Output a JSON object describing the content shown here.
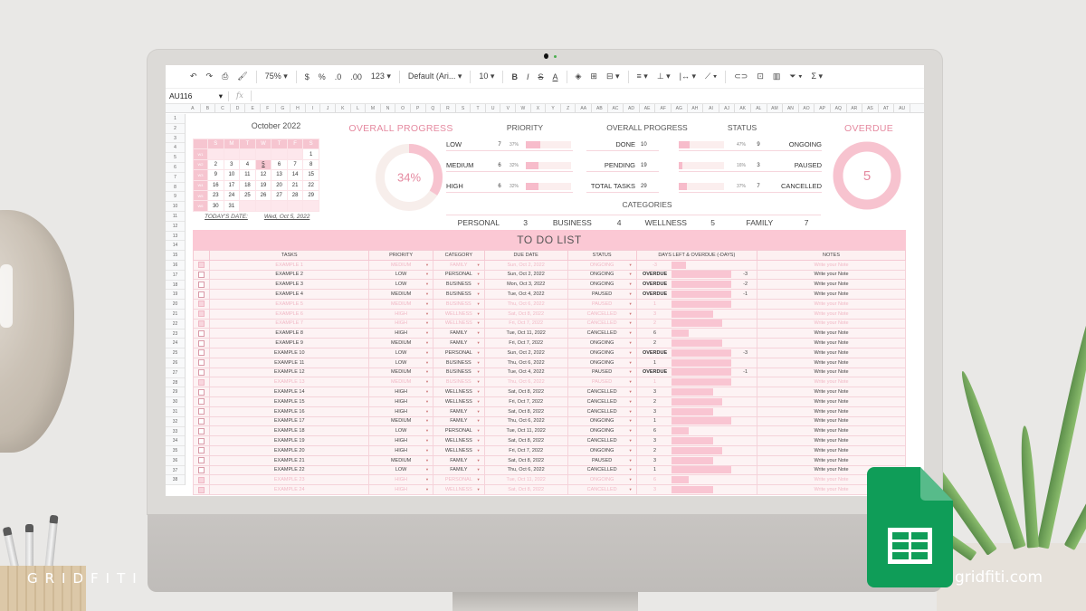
{
  "branding": {
    "watermark_left": "GRIDFITI",
    "watermark_right": "gridfiti.com",
    "app_icon": "google-sheets-icon"
  },
  "toolbar": {
    "items": [
      {
        "name": "undo-icon",
        "glyph": "↶"
      },
      {
        "name": "redo-icon",
        "glyph": "↷"
      },
      {
        "name": "print-icon",
        "glyph": "⎙"
      },
      {
        "name": "paint-format-icon",
        "glyph": "🖌"
      },
      {
        "name": "zoom-select",
        "label": "75%  ▾"
      },
      {
        "name": "currency-button",
        "label": "$"
      },
      {
        "name": "percent-button",
        "label": "%"
      },
      {
        "name": "decrease-decimal-button",
        "label": ".0"
      },
      {
        "name": "increase-decimal-button",
        "label": ".00"
      },
      {
        "name": "more-formats-button",
        "label": "123 ▾"
      },
      {
        "name": "font-select",
        "label": "Default (Ari...  ▾"
      },
      {
        "name": "font-size-select",
        "label": "10      ▾"
      },
      {
        "name": "bold-button",
        "label": "B"
      },
      {
        "name": "italic-button",
        "label": "I"
      },
      {
        "name": "strikethrough-button",
        "label": "S"
      },
      {
        "name": "text-color-button",
        "label": "A"
      },
      {
        "name": "fill-color-icon",
        "glyph": "◈"
      },
      {
        "name": "borders-icon",
        "glyph": "⊞"
      },
      {
        "name": "merge-cells-icon",
        "glyph": "⊟ ▾"
      },
      {
        "name": "align-icon",
        "glyph": "≡ ▾"
      },
      {
        "name": "valign-icon",
        "glyph": "⊥ ▾"
      },
      {
        "name": "wrap-icon",
        "glyph": "|↔ ▾"
      },
      {
        "name": "rotate-icon",
        "glyph": "⟋ ▾"
      },
      {
        "name": "link-icon",
        "glyph": "⊂⊃"
      },
      {
        "name": "comment-icon",
        "glyph": "⊡"
      },
      {
        "name": "chart-icon",
        "glyph": "▥"
      },
      {
        "name": "filter-icon",
        "glyph": "⏷ ▾"
      },
      {
        "name": "functions-icon",
        "glyph": "Σ ▾"
      }
    ]
  },
  "formula_bar": {
    "cell_ref": "AU116",
    "fx": "fx",
    "value": ""
  },
  "columns": [
    "A",
    "B",
    "C",
    "D",
    "E",
    "F",
    "G",
    "H",
    "I",
    "J",
    "K",
    "L",
    "M",
    "N",
    "O",
    "P",
    "Q",
    "R",
    "S",
    "T",
    "U",
    "V",
    "W",
    "X",
    "Y",
    "Z",
    "AA",
    "AB",
    "AC",
    "AD",
    "AE",
    "AF",
    "AG",
    "AH",
    "AI",
    "AJ",
    "AK",
    "AL",
    "AM",
    "AN",
    "AO",
    "AP",
    "AQ",
    "AR",
    "AS",
    "AT",
    "AU"
  ],
  "rows": [
    "1",
    "2",
    "3",
    "4",
    "5",
    "6",
    "7",
    "8",
    "9",
    "10",
    "11",
    "12",
    "13",
    "14",
    "15",
    "16",
    "17",
    "18",
    "19",
    "20",
    "21",
    "22",
    "23",
    "24",
    "25",
    "26",
    "27",
    "28",
    "29",
    "30",
    "31",
    "32",
    "33",
    "34",
    "35",
    "36",
    "37",
    "38"
  ],
  "calendar": {
    "title": "October 2022",
    "weekdays": [
      "S",
      "M",
      "T",
      "W",
      "T",
      "F",
      "S"
    ],
    "weeks": [
      {
        "wk": "W1",
        "days": [
          "",
          "",
          "",
          "",
          "",
          "",
          "1"
        ]
      },
      {
        "wk": "W2",
        "days": [
          "2",
          "3",
          "4",
          "5",
          "6",
          "7",
          "8"
        ]
      },
      {
        "wk": "W3",
        "days": [
          "9",
          "10",
          "11",
          "12",
          "13",
          "14",
          "15"
        ]
      },
      {
        "wk": "W4",
        "days": [
          "16",
          "17",
          "18",
          "19",
          "20",
          "21",
          "22"
        ]
      },
      {
        "wk": "W5",
        "days": [
          "23",
          "24",
          "25",
          "26",
          "27",
          "28",
          "29"
        ]
      },
      {
        "wk": "W6",
        "days": [
          "30",
          "31",
          "",
          "",
          "",
          "",
          ""
        ]
      }
    ],
    "today_label": "TODAY'S DATE:",
    "today_value": "Wed, Oct 5, 2022",
    "today_day": "5"
  },
  "overall_progress": {
    "title": "OVERALL PROGRESS",
    "percent_label": "34%",
    "fraction": 0.34
  },
  "priority": {
    "title": "PRIORITY",
    "rows": [
      {
        "label": "LOW",
        "count": "7",
        "pct": "37%",
        "fraction": 0.37
      },
      {
        "label": "MEDIUM",
        "count": "6",
        "pct": "32%",
        "fraction": 0.32
      },
      {
        "label": "HIGH",
        "count": "6",
        "pct": "32%",
        "fraction": 0.32
      }
    ]
  },
  "overall_counts": {
    "title": "OVERALL PROGRESS",
    "rows": [
      {
        "label": "DONE",
        "value": "10"
      },
      {
        "label": "PENDING",
        "value": "19"
      },
      {
        "label": "TOTAL TASKS",
        "value": "29"
      }
    ]
  },
  "status": {
    "title": "STATUS",
    "rows": [
      {
        "label": "ONGOING",
        "count": "9",
        "pct": "47%",
        "fraction": 0.47
      },
      {
        "label": "PAUSED",
        "count": "3",
        "pct": "16%",
        "fraction": 0.16
      },
      {
        "label": "CANCELLED",
        "count": "7",
        "pct": "37%",
        "fraction": 0.37
      }
    ]
  },
  "overdue": {
    "title": "OVERDUE",
    "value": "5"
  },
  "categories": {
    "title": "CATEGORIES",
    "items": [
      {
        "label": "PERSONAL",
        "value": "3"
      },
      {
        "label": "BUSINESS",
        "value": "4"
      },
      {
        "label": "WELLNESS",
        "value": "5"
      },
      {
        "label": "FAMILY",
        "value": "7"
      }
    ]
  },
  "todo": {
    "title": "TO DO LIST",
    "headers": [
      "",
      "TASKS",
      "PRIORITY",
      "CATEGORY",
      "DUE DATE",
      "STATUS",
      "DAYS LEFT & OVERDUE (-DAYS)",
      "NOTES"
    ],
    "rows": [
      {
        "done": true,
        "task": "EXAMPLE 1",
        "priority": "MEDIUM",
        "category": "FAMILY",
        "due": "Sun, Oct 2, 2022",
        "status": "ONGOING",
        "days": "-3",
        "overdue": "",
        "bar": 0.25,
        "note": "Write your Note"
      },
      {
        "done": false,
        "task": "EXAMPLE 2",
        "priority": "LOW",
        "category": "PERSONAL",
        "due": "Sun, Oct 2, 2022",
        "status": "ONGOING",
        "days": "-3",
        "overdue": "OVERDUE",
        "bar": 1.0,
        "note": "Write your Note"
      },
      {
        "done": false,
        "task": "EXAMPLE 3",
        "priority": "LOW",
        "category": "BUSINESS",
        "due": "Mon, Oct 3, 2022",
        "status": "ONGOING",
        "days": "-2",
        "overdue": "OVERDUE",
        "bar": 1.0,
        "note": "Write your Note"
      },
      {
        "done": false,
        "task": "EXAMPLE 4",
        "priority": "MEDIUM",
        "category": "BUSINESS",
        "due": "Tue, Oct 4, 2022",
        "status": "PAUSED",
        "days": "-1",
        "overdue": "OVERDUE",
        "bar": 1.0,
        "note": "Write your Note"
      },
      {
        "done": true,
        "task": "EXAMPLE 5",
        "priority": "MEDIUM",
        "category": "BUSINESS",
        "due": "Thu, Oct 6, 2022",
        "status": "PAUSED",
        "days": "1",
        "overdue": "",
        "bar": 1.0,
        "note": "Write your Note"
      },
      {
        "done": true,
        "task": "EXAMPLE 6",
        "priority": "HIGH",
        "category": "WELLNESS",
        "due": "Sat, Oct 8, 2022",
        "status": "CANCELLED",
        "days": "3",
        "overdue": "",
        "bar": 0.7,
        "note": "Write your Note"
      },
      {
        "done": true,
        "task": "EXAMPLE 7",
        "priority": "HIGH",
        "category": "WELLNESS",
        "due": "Fri, Oct 7, 2022",
        "status": "CANCELLED",
        "days": "2",
        "overdue": "",
        "bar": 0.85,
        "note": "Write your Note"
      },
      {
        "done": false,
        "task": "EXAMPLE 8",
        "priority": "HIGH",
        "category": "FAMILY",
        "due": "Tue, Oct 11, 2022",
        "status": "CANCELLED",
        "days": "6",
        "overdue": "",
        "bar": 0.3,
        "note": "Write your Note"
      },
      {
        "done": false,
        "task": "EXAMPLE 9",
        "priority": "MEDIUM",
        "category": "FAMILY",
        "due": "Fri, Oct 7, 2022",
        "status": "ONGOING",
        "days": "2",
        "overdue": "",
        "bar": 0.85,
        "note": "Write your Note"
      },
      {
        "done": false,
        "task": "EXAMPLE 10",
        "priority": "LOW",
        "category": "PERSONAL",
        "due": "Sun, Oct 2, 2022",
        "status": "ONGOING",
        "days": "-3",
        "overdue": "OVERDUE",
        "bar": 1.0,
        "note": "Write your Note"
      },
      {
        "done": false,
        "task": "EXAMPLE 11",
        "priority": "LOW",
        "category": "BUSINESS",
        "due": "Thu, Oct 6, 2022",
        "status": "ONGOING",
        "days": "1",
        "overdue": "",
        "bar": 1.0,
        "note": "Write your Note"
      },
      {
        "done": false,
        "task": "EXAMPLE 12",
        "priority": "MEDIUM",
        "category": "BUSINESS",
        "due": "Tue, Oct 4, 2022",
        "status": "PAUSED",
        "days": "-1",
        "overdue": "OVERDUE",
        "bar": 1.0,
        "note": "Write your Note"
      },
      {
        "done": true,
        "task": "EXAMPLE 13",
        "priority": "MEDIUM",
        "category": "BUSINESS",
        "due": "Thu, Oct 6, 2022",
        "status": "PAUSED",
        "days": "1",
        "overdue": "",
        "bar": 1.0,
        "note": "Write your Note"
      },
      {
        "done": false,
        "task": "EXAMPLE 14",
        "priority": "HIGH",
        "category": "WELLNESS",
        "due": "Sat, Oct 8, 2022",
        "status": "CANCELLED",
        "days": "3",
        "overdue": "",
        "bar": 0.7,
        "note": "Write your Note"
      },
      {
        "done": false,
        "task": "EXAMPLE 15",
        "priority": "HIGH",
        "category": "WELLNESS",
        "due": "Fri, Oct 7, 2022",
        "status": "CANCELLED",
        "days": "2",
        "overdue": "",
        "bar": 0.85,
        "note": "Write your Note"
      },
      {
        "done": false,
        "task": "EXAMPLE 16",
        "priority": "HIGH",
        "category": "FAMILY",
        "due": "Sat, Oct 8, 2022",
        "status": "CANCELLED",
        "days": "3",
        "overdue": "",
        "bar": 0.7,
        "note": "Write your Note"
      },
      {
        "done": false,
        "task": "EXAMPLE 17",
        "priority": "MEDIUM",
        "category": "FAMILY",
        "due": "Thu, Oct 6, 2022",
        "status": "ONGOING",
        "days": "1",
        "overdue": "",
        "bar": 1.0,
        "note": "Write your Note"
      },
      {
        "done": false,
        "task": "EXAMPLE 18",
        "priority": "LOW",
        "category": "PERSONAL",
        "due": "Tue, Oct 11, 2022",
        "status": "ONGOING",
        "days": "6",
        "overdue": "",
        "bar": 0.3,
        "note": "Write your Note"
      },
      {
        "done": false,
        "task": "EXAMPLE 19",
        "priority": "HIGH",
        "category": "WELLNESS",
        "due": "Sat, Oct 8, 2022",
        "status": "CANCELLED",
        "days": "3",
        "overdue": "",
        "bar": 0.7,
        "note": "Write your Note"
      },
      {
        "done": false,
        "task": "EXAMPLE 20",
        "priority": "HIGH",
        "category": "WELLNESS",
        "due": "Fri, Oct 7, 2022",
        "status": "ONGOING",
        "days": "2",
        "overdue": "",
        "bar": 0.85,
        "note": "Write your Note"
      },
      {
        "done": false,
        "task": "EXAMPLE 21",
        "priority": "MEDIUM",
        "category": "FAMILY",
        "due": "Sat, Oct 8, 2022",
        "status": "PAUSED",
        "days": "3",
        "overdue": "",
        "bar": 0.7,
        "note": "Write your Note"
      },
      {
        "done": false,
        "task": "EXAMPLE 22",
        "priority": "LOW",
        "category": "FAMILY",
        "due": "Thu, Oct 6, 2022",
        "status": "CANCELLED",
        "days": "1",
        "overdue": "",
        "bar": 1.0,
        "note": "Write your Note"
      },
      {
        "done": true,
        "task": "EXAMPLE 23",
        "priority": "HIGH",
        "category": "PERSONAL",
        "due": "Tue, Oct 11, 2022",
        "status": "ONGOING",
        "days": "6",
        "overdue": "",
        "bar": 0.3,
        "note": "Write your Note"
      },
      {
        "done": true,
        "task": "EXAMPLE 24",
        "priority": "HIGH",
        "category": "WELLNESS",
        "due": "Sat, Oct 8, 2022",
        "status": "CANCELLED",
        "days": "3",
        "overdue": "",
        "bar": 0.7,
        "note": "Write your Note"
      }
    ]
  },
  "colors": {
    "accent_pink": "#f6c5d0",
    "title_pink": "#e58aa0",
    "sheets_green": "#0f9d58"
  }
}
